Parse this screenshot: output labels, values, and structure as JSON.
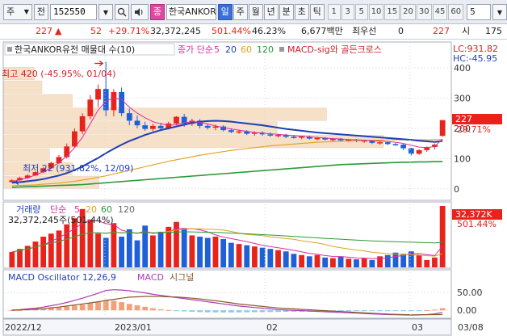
{
  "toolbar": {
    "chart_type_label": "주",
    "prev_label": "전",
    "code": "152550",
    "name_tag": "종",
    "stock_name": "한국ANKOR유",
    "periods": [
      "일",
      "주",
      "월",
      "년",
      "분",
      "초",
      "틱"
    ],
    "active_period": 0,
    "numbers": [
      "1",
      "3",
      "5",
      "10",
      "15",
      "20",
      "30",
      "45",
      "60"
    ],
    "last_field": "5"
  },
  "quote": {
    "price": "227",
    "change": "52",
    "change_pct": "+29.71%",
    "volume": "32,372,245",
    "volume_pct": "501.44%",
    "turnover_pct": "46.23%",
    "amount": "6,677백만",
    "broker": "최우선",
    "bid": "0",
    "ask": "227",
    "tail_label": "시",
    "tail_value": "175"
  },
  "legend": {
    "title": "한국ANKOR유전 매물대 수(10)",
    "ma_label": "종가 단순",
    "ma_periods": [
      "5",
      "20",
      "60",
      "120"
    ],
    "macd_label": "MACD-sig와 골든크로스",
    "high_note": "최고 420 (-45.95%, 01/04)",
    "low_note": "최저 22 (931.82%, 12/09)",
    "lc": "LC:931.82",
    "hc": "HC:-45.95",
    "last_price_tag": "227",
    "last_change_tag": "29.71%"
  },
  "volume_legend": {
    "title": "거래량",
    "ma_label": "단순",
    "ma_periods": [
      "5",
      "20",
      "60",
      "120"
    ],
    "value": "32,372,245주(501.44%)",
    "tag_value": "32,372K",
    "tag_pct": "501.44%"
  },
  "macd_legend": {
    "title": "MACD Oscillator 12,26,9",
    "macd": "MACD",
    "signal": "시그널"
  },
  "x_labels": [
    "2022/12",
    "2023/01",
    "02",
    "03",
    "03/08"
  ],
  "colors": {
    "up": "#e8231c",
    "down": "#1f5fd8",
    "ma5": "#d92fa0",
    "ma20": "#1f3fb5",
    "ma60": "#e0a020",
    "ma120": "#2a9a3a",
    "volume_profile": "#f6e0c8"
  },
  "chart_data": [
    {
      "type": "candlestick",
      "title": "한국ANKOR유전 매물대 수(10)",
      "ylim": [
        -30,
        440
      ],
      "yticks": [
        0,
        100,
        200,
        300,
        400
      ],
      "candles": [
        {
          "o": 22,
          "h": 32,
          "l": 22,
          "c": 28
        },
        {
          "o": 28,
          "h": 40,
          "l": 26,
          "c": 36
        },
        {
          "o": 36,
          "h": 48,
          "l": 33,
          "c": 44
        },
        {
          "o": 44,
          "h": 58,
          "l": 42,
          "c": 55
        },
        {
          "o": 55,
          "h": 72,
          "l": 52,
          "c": 68
        },
        {
          "o": 68,
          "h": 90,
          "l": 66,
          "c": 85
        },
        {
          "o": 85,
          "h": 112,
          "l": 82,
          "c": 105
        },
        {
          "o": 105,
          "h": 150,
          "l": 100,
          "c": 140
        },
        {
          "o": 140,
          "h": 200,
          "l": 135,
          "c": 190
        },
        {
          "o": 190,
          "h": 250,
          "l": 180,
          "c": 240
        },
        {
          "o": 240,
          "h": 310,
          "l": 230,
          "c": 295
        },
        {
          "o": 295,
          "h": 345,
          "l": 270,
          "c": 330
        },
        {
          "o": 330,
          "h": 420,
          "l": 240,
          "c": 260
        },
        {
          "o": 260,
          "h": 330,
          "l": 240,
          "c": 320
        },
        {
          "o": 320,
          "h": 335,
          "l": 240,
          "c": 250
        },
        {
          "o": 250,
          "h": 265,
          "l": 210,
          "c": 225
        },
        {
          "o": 225,
          "h": 242,
          "l": 200,
          "c": 210
        },
        {
          "o": 210,
          "h": 222,
          "l": 192,
          "c": 198
        },
        {
          "o": 198,
          "h": 215,
          "l": 190,
          "c": 208
        },
        {
          "o": 208,
          "h": 218,
          "l": 195,
          "c": 200
        },
        {
          "o": 200,
          "h": 222,
          "l": 196,
          "c": 216
        },
        {
          "o": 216,
          "h": 240,
          "l": 210,
          "c": 238
        },
        {
          "o": 238,
          "h": 248,
          "l": 205,
          "c": 215
        },
        {
          "o": 215,
          "h": 232,
          "l": 208,
          "c": 225
        },
        {
          "o": 225,
          "h": 230,
          "l": 200,
          "c": 208
        },
        {
          "o": 208,
          "h": 216,
          "l": 196,
          "c": 202
        },
        {
          "o": 202,
          "h": 212,
          "l": 194,
          "c": 206
        },
        {
          "o": 206,
          "h": 210,
          "l": 190,
          "c": 194
        },
        {
          "o": 194,
          "h": 200,
          "l": 184,
          "c": 188
        },
        {
          "o": 188,
          "h": 196,
          "l": 182,
          "c": 190
        },
        {
          "o": 190,
          "h": 194,
          "l": 178,
          "c": 182
        },
        {
          "o": 182,
          "h": 190,
          "l": 176,
          "c": 186
        },
        {
          "o": 186,
          "h": 190,
          "l": 176,
          "c": 180
        },
        {
          "o": 180,
          "h": 186,
          "l": 172,
          "c": 176
        },
        {
          "o": 176,
          "h": 182,
          "l": 170,
          "c": 178
        },
        {
          "o": 178,
          "h": 182,
          "l": 168,
          "c": 172
        },
        {
          "o": 172,
          "h": 178,
          "l": 166,
          "c": 170
        },
        {
          "o": 170,
          "h": 176,
          "l": 164,
          "c": 173
        },
        {
          "o": 173,
          "h": 176,
          "l": 163,
          "c": 166
        },
        {
          "o": 166,
          "h": 172,
          "l": 160,
          "c": 168
        },
        {
          "o": 168,
          "h": 171,
          "l": 160,
          "c": 163
        },
        {
          "o": 163,
          "h": 168,
          "l": 158,
          "c": 165
        },
        {
          "o": 165,
          "h": 168,
          "l": 156,
          "c": 160
        },
        {
          "o": 160,
          "h": 165,
          "l": 155,
          "c": 162
        },
        {
          "o": 162,
          "h": 165,
          "l": 154,
          "c": 158
        },
        {
          "o": 158,
          "h": 162,
          "l": 152,
          "c": 160
        },
        {
          "o": 160,
          "h": 162,
          "l": 148,
          "c": 152
        },
        {
          "o": 152,
          "h": 156,
          "l": 146,
          "c": 154
        },
        {
          "o": 154,
          "h": 156,
          "l": 144,
          "c": 148
        },
        {
          "o": 148,
          "h": 152,
          "l": 142,
          "c": 146
        },
        {
          "o": 146,
          "h": 150,
          "l": 128,
          "c": 134
        },
        {
          "o": 134,
          "h": 136,
          "l": 110,
          "c": 116
        },
        {
          "o": 116,
          "h": 130,
          "l": 112,
          "c": 128
        },
        {
          "o": 128,
          "h": 140,
          "l": 122,
          "c": 138
        },
        {
          "o": 138,
          "h": 150,
          "l": 130,
          "c": 146
        },
        {
          "o": 175,
          "h": 227,
          "l": 172,
          "c": 227
        }
      ],
      "ma5": [
        24,
        30,
        36,
        46,
        56,
        70,
        86,
        108,
        136,
        170,
        215,
        260,
        290,
        300,
        295,
        270,
        250,
        235,
        222,
        215,
        210,
        212,
        218,
        222,
        220,
        214,
        208,
        202,
        198,
        194,
        190,
        186,
        184,
        182,
        180,
        178,
        176,
        174,
        172,
        170,
        168,
        166,
        165,
        163,
        162,
        161,
        159,
        158,
        156,
        154,
        150,
        144,
        138,
        136,
        140,
        165
      ],
      "ma20": [
        20,
        22,
        25,
        28,
        32,
        38,
        44,
        52,
        62,
        74,
        88,
        102,
        118,
        132,
        146,
        158,
        168,
        178,
        186,
        194,
        200,
        206,
        212,
        218,
        222,
        224,
        225,
        224,
        222,
        219,
        216,
        213,
        210,
        206,
        202,
        198,
        195,
        192,
        189,
        186,
        184,
        182,
        180,
        178,
        176,
        174,
        172,
        170,
        168,
        166,
        164,
        162,
        159,
        157,
        155,
        158
      ],
      "ma60": [
        10,
        11,
        12,
        13,
        15,
        17,
        19,
        22,
        25,
        29,
        33,
        38,
        43,
        49,
        55,
        61,
        67,
        73,
        79,
        85,
        91,
        96,
        101,
        106,
        111,
        115,
        119,
        123,
        127,
        130,
        133,
        136,
        139,
        142,
        144,
        146,
        148,
        150,
        152,
        154,
        155,
        156,
        157,
        158,
        159,
        160,
        161,
        161,
        162,
        162,
        162,
        162,
        162,
        162,
        162,
        163
      ],
      "ma120": [
        5,
        6,
        7,
        8,
        9,
        10,
        11,
        12,
        13,
        14,
        16,
        18,
        20,
        22,
        24,
        26,
        28,
        30,
        32,
        34,
        36,
        38,
        40,
        42,
        44,
        46,
        48,
        50,
        52,
        54,
        56,
        58,
        60,
        62,
        64,
        66,
        68,
        70,
        72,
        74,
        76,
        78,
        80,
        81,
        82,
        83,
        84,
        85,
        86,
        87,
        88,
        88,
        89,
        89,
        90,
        90
      ],
      "volume_profile": [
        {
          "price": 20,
          "width": 0.25
        },
        {
          "price": 65,
          "width": 0.18
        },
        {
          "price": 110,
          "width": 0.12
        },
        {
          "price": 155,
          "width": 1.0
        },
        {
          "price": 200,
          "width": 0.72
        },
        {
          "price": 245,
          "width": 0.85
        },
        {
          "price": 290,
          "width": 0.18
        },
        {
          "price": 335,
          "width": 0.1
        },
        {
          "price": 380,
          "width": 0.08
        }
      ]
    },
    {
      "type": "bar",
      "title": "거래량",
      "values": [
        0.25,
        0.3,
        0.35,
        0.42,
        0.5,
        0.55,
        0.6,
        0.7,
        0.8,
        0.95,
        0.78,
        0.55,
        0.48,
        0.72,
        0.5,
        0.62,
        0.44,
        0.68,
        0.52,
        0.58,
        0.66,
        0.74,
        0.64,
        0.52,
        0.5,
        0.48,
        0.5,
        0.46,
        0.4,
        0.38,
        0.36,
        0.34,
        0.32,
        0.3,
        0.28,
        0.26,
        0.22,
        0.2,
        0.18,
        0.2,
        0.16,
        0.15,
        0.18,
        0.14,
        0.13,
        0.15,
        0.12,
        0.18,
        0.2,
        0.24,
        0.22,
        0.26,
        0.2,
        0.12,
        0.16,
        1.0
      ]
    },
    {
      "type": "bar",
      "title": "MACD Oscillator 12,26,9",
      "ylim": [
        -20,
        80
      ],
      "yticks": [
        0,
        50
      ],
      "ytick_labels": [
        "0.00",
        "50.00"
      ],
      "values": [
        0.5,
        1,
        2,
        3,
        4.5,
        6,
        8,
        10.5,
        13,
        16,
        20,
        24,
        28,
        27,
        23,
        18,
        14,
        10,
        6,
        3,
        1,
        -1.5,
        -3,
        -4,
        -5,
        -5.5,
        -5.8,
        -6,
        -6,
        -5.8,
        -5.5,
        -5.2,
        -5,
        -4.8,
        -4.5,
        -4.2,
        -4,
        -3.8,
        -3.5,
        -3.2,
        -3,
        -2.8,
        -2.6,
        -2.4,
        -2.2,
        -2,
        -1.8,
        -1.6,
        -1.4,
        -1.2,
        -1,
        -0.8,
        -0.5,
        0.5,
        2,
        6
      ],
      "macd": [
        1,
        2,
        4,
        6,
        9,
        13,
        17,
        22,
        28,
        34,
        41,
        48,
        56,
        58,
        57,
        55,
        52,
        49,
        45,
        42,
        39,
        36,
        33,
        30,
        27,
        24,
        21,
        18,
        15,
        12,
        10,
        8,
        6,
        4,
        2,
        1,
        0,
        -1,
        -2,
        -3,
        -4,
        -5,
        -6,
        -7,
        -8,
        -9,
        -10,
        -11,
        -12,
        -12.5,
        -13,
        -13.5,
        -13,
        -12,
        -10,
        -6
      ],
      "signal": [
        0.5,
        1,
        2,
        3,
        4.5,
        7,
        9,
        12,
        15,
        18,
        21,
        24,
        28,
        31,
        34,
        37,
        38,
        39,
        39,
        39,
        38,
        37.5,
        36,
        34,
        32,
        29.5,
        26.8,
        24,
        21,
        17.8,
        15.5,
        13.2,
        11,
        8.8,
        6.5,
        5.2,
        4,
        2.8,
        1.5,
        0.2,
        -1,
        -2.2,
        -3.4,
        -4.6,
        -5.8,
        -7,
        -8.2,
        -9.4,
        -10.6,
        -11.3,
        -12,
        -12.7,
        -12.5,
        -12.5,
        -12,
        -12
      ]
    }
  ]
}
